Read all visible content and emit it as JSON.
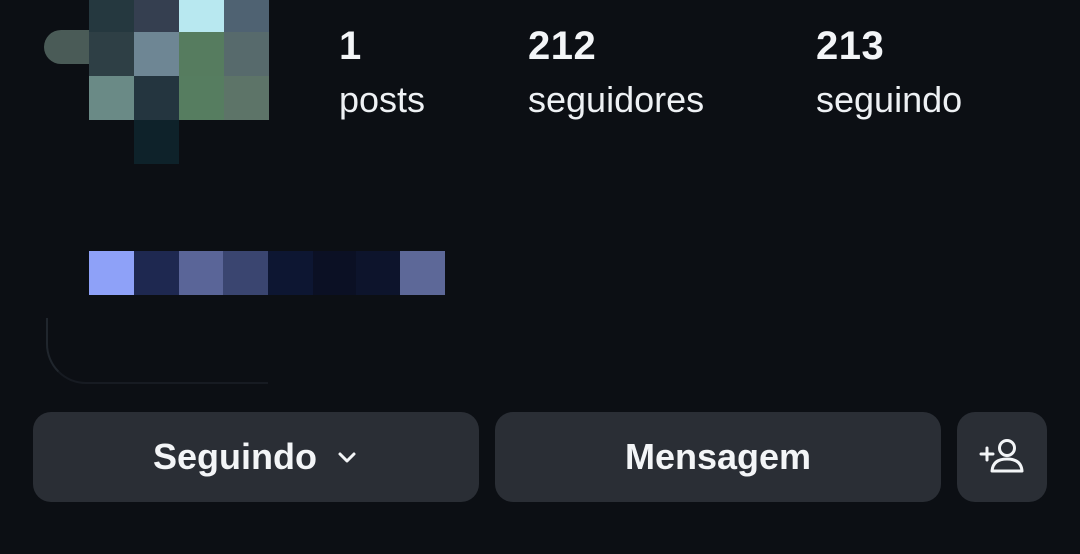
{
  "profile": {
    "stats": [
      {
        "value": "1",
        "label": "posts"
      },
      {
        "value": "212",
        "label": "seguidores"
      },
      {
        "value": "213",
        "label": "seguindo"
      }
    ]
  },
  "actions": {
    "following_label": "Seguindo",
    "message_label": "Mensagem",
    "following_icon": "chevron-down-icon",
    "add_user_icon": "add-person-icon"
  },
  "colors": {
    "background": "#0c0f14",
    "button_bg": "#2a2e35",
    "text": "#f3f5f7"
  }
}
